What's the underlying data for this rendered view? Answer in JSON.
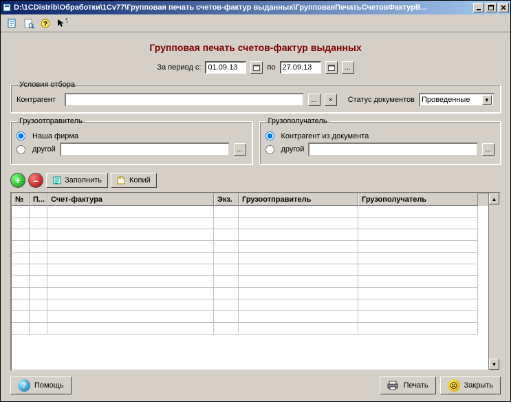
{
  "window": {
    "title": "D:\\1CDistrib\\Обработки\\1Cv77\\Групповая печать счетов-фактур выданных\\ГрупповаяПечатьСчетовФактурВ..."
  },
  "toolbar_icons": [
    "new-doc-icon",
    "open-doc-icon",
    "help-icon",
    "pointer-help-icon"
  ],
  "heading": "Групповая печать счетов-фактур выданных",
  "period": {
    "label_from": "За период с:",
    "date_from": "01.09.13",
    "label_to": "по",
    "date_to": "27.09.13"
  },
  "filter": {
    "legend": "Условия отбора",
    "counterparty_label": "Контрагент",
    "counterparty_value": "",
    "ellipsis": "...",
    "clear": "×",
    "status_label": "Статус документов",
    "status_value": "Проведенные"
  },
  "shipper": {
    "legend": "Грузоотправитель",
    "opt_ours": "Наша фирма",
    "opt_other": "другой",
    "other_value": "",
    "ellipsis": "..."
  },
  "consignee": {
    "legend": "Грузополучатель",
    "opt_from_doc": "Контрагент из документа",
    "opt_other": "другой",
    "other_value": "",
    "ellipsis": "..."
  },
  "actions": {
    "add": "+",
    "remove": "–",
    "fill": "Заполнить",
    "copies": "Копий"
  },
  "table": {
    "columns": {
      "num": "№",
      "p": "П...",
      "invoice": "Счет-фактура",
      "copies": "Экз.",
      "shipper": "Грузоотправитель",
      "consignee": "Грузополучатель"
    },
    "rows": []
  },
  "footer": {
    "help": "Помощь",
    "print": "Печать",
    "close": "Закрыть"
  }
}
